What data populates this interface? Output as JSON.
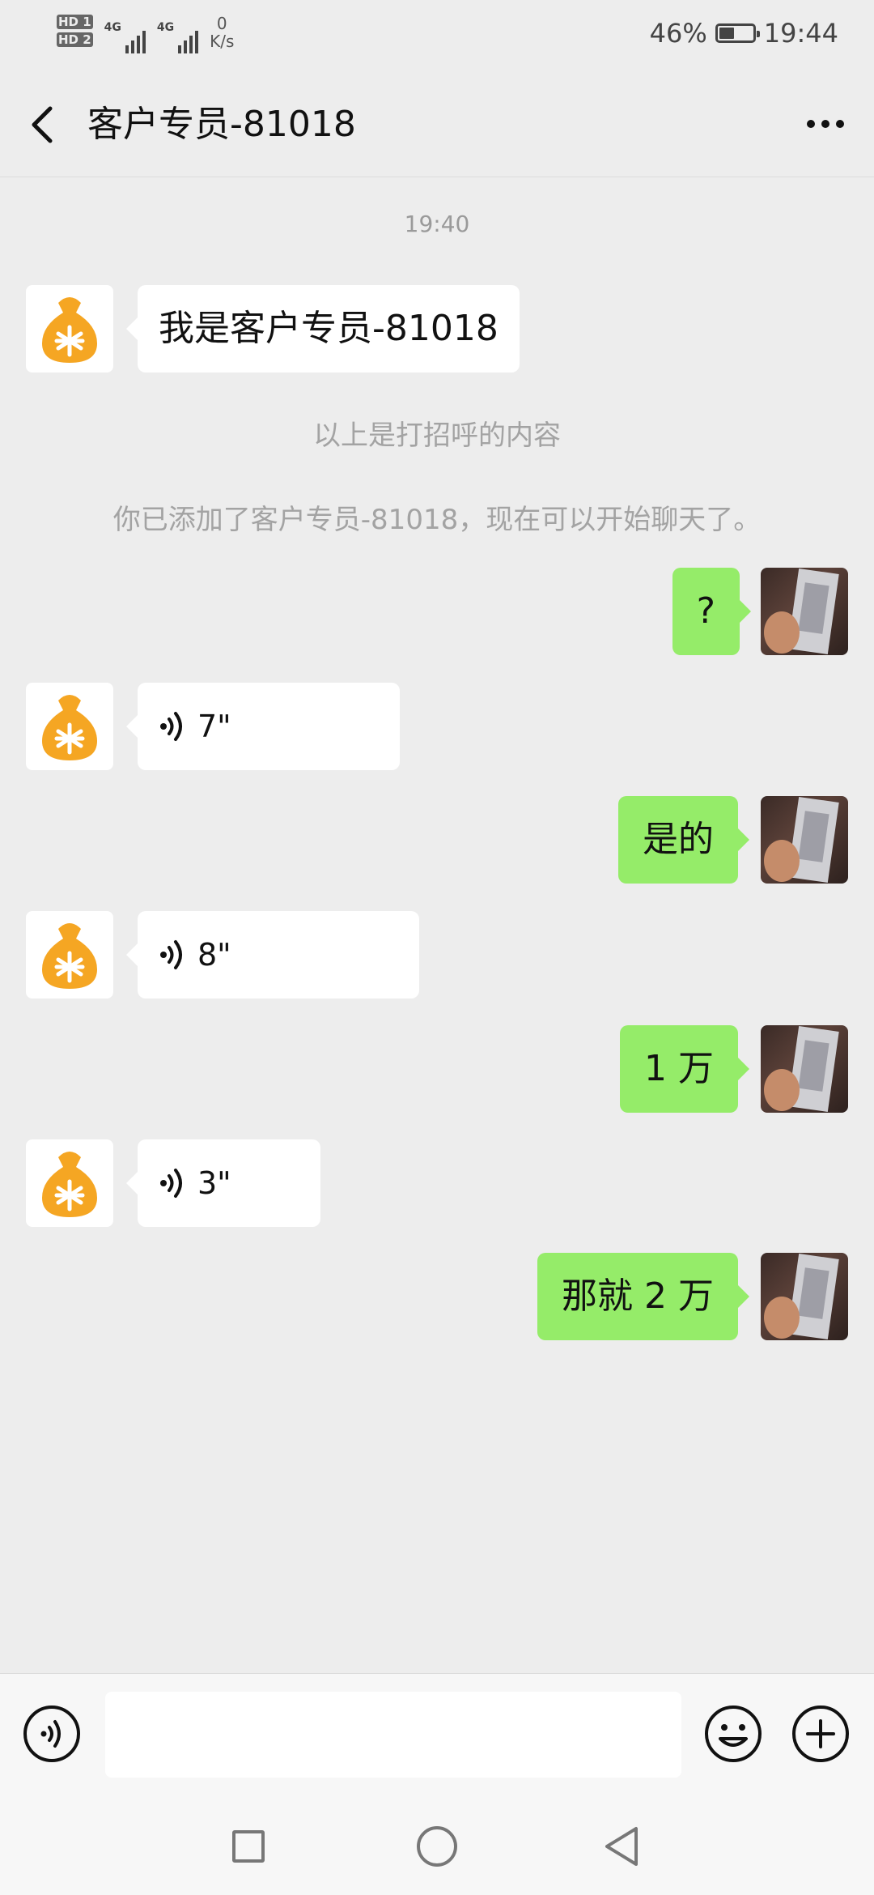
{
  "status_bar": {
    "sim1": "HD 1",
    "sim2": "HD 2",
    "signal1": "4G",
    "signal2": "4G",
    "speed_value": "0",
    "speed_unit": "K/s",
    "battery_percent": "46%",
    "battery_level": 0.46,
    "time": "19:44"
  },
  "header": {
    "title": "客户专员-81018",
    "back_icon": "chevron-left-icon",
    "more_icon": "more-horizontal-icon"
  },
  "chat": {
    "timestamp": "19:40",
    "greeting": "我是客户专员-81018",
    "system_notice_1": "以上是打招呼的内容",
    "system_notice_2": "你已添加了客户专员-81018，现在可以开始聊天了。",
    "messages": [
      {
        "from": "me",
        "text": "?"
      },
      {
        "from": "them",
        "type": "voice",
        "duration": "7\""
      },
      {
        "from": "me",
        "text": "是的"
      },
      {
        "from": "them",
        "type": "voice",
        "duration": "8\""
      },
      {
        "from": "me",
        "text": "1 万"
      },
      {
        "from": "them",
        "type": "voice",
        "duration": "3\""
      },
      {
        "from": "me",
        "text": "那就 2 万"
      }
    ]
  },
  "input_bar": {
    "placeholder": "",
    "voice_icon": "voice-mode-icon",
    "emoji_icon": "emoji-icon",
    "plus_icon": "plus-icon"
  },
  "system_nav": {
    "recent_icon": "square-icon",
    "home_icon": "circle-icon",
    "back_icon": "triangle-back-icon"
  },
  "colors": {
    "background": "#ededed",
    "out_bubble": "#95ec69",
    "in_bubble": "#ffffff",
    "avatar_bag": "#f5a623"
  }
}
